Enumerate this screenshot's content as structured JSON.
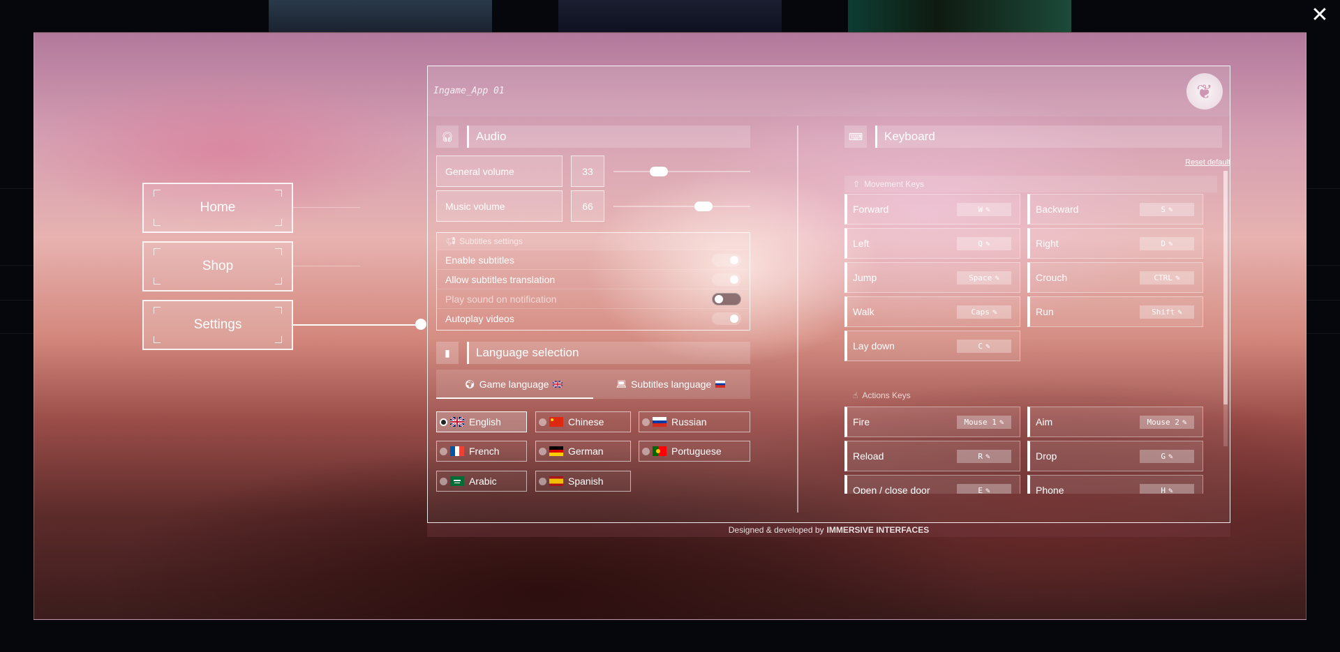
{
  "window": {
    "close_icon": "close-icon"
  },
  "nav": {
    "items": [
      {
        "label": "Home",
        "active": false
      },
      {
        "label": "Shop",
        "active": false
      },
      {
        "label": "Settings",
        "active": true
      }
    ]
  },
  "app": {
    "title": "Ingame_App 01",
    "logo_icon": "phoenix-logo-icon"
  },
  "audio": {
    "title": "Audio",
    "icon": "headphones-icon",
    "general_volume": {
      "label": "General volume",
      "value": "33",
      "level": 0.33
    },
    "music_volume": {
      "label": "Music volume",
      "value": "66",
      "level": 0.66
    }
  },
  "subtitles": {
    "title": "Subtitles settings",
    "icon": "megaphone-icon",
    "options": [
      {
        "label": "Enable subtitles",
        "on": true
      },
      {
        "label": "Allow subtitles translation",
        "on": true
      },
      {
        "label": "Play sound on notification",
        "on": false
      },
      {
        "label": "Autoplay videos",
        "on": true
      }
    ]
  },
  "language": {
    "title": "Language selection",
    "icon": "chat-bubble-icon",
    "tabs": [
      {
        "label": "Game language",
        "icon": "globe-icon",
        "flag": "uk-flag-icon",
        "active": true
      },
      {
        "label": "Subtitles language",
        "icon": "laptop-icon",
        "flag": "russia-flag-icon",
        "active": false
      }
    ],
    "options": [
      {
        "label": "English",
        "flag": "uk",
        "selected": true
      },
      {
        "label": "Chinese",
        "flag": "china",
        "selected": false
      },
      {
        "label": "Russian",
        "flag": "russia",
        "selected": false
      },
      {
        "label": "French",
        "flag": "france",
        "selected": false
      },
      {
        "label": "German",
        "flag": "germany",
        "selected": false
      },
      {
        "label": "Portuguese",
        "flag": "portugal",
        "selected": false
      },
      {
        "label": "Arabic",
        "flag": "saudi",
        "selected": false
      },
      {
        "label": "Spanish",
        "flag": "spain",
        "selected": false
      }
    ]
  },
  "keyboard": {
    "title": "Keyboard",
    "icon": "keyboard-icon",
    "reset_label": "Reset default",
    "movement": {
      "title": "Movement Keys",
      "icon": "arrow-up-icon",
      "keys": [
        {
          "label": "Forward",
          "key": "W"
        },
        {
          "label": "Backward",
          "key": "S"
        },
        {
          "label": "Left",
          "key": "Q"
        },
        {
          "label": "Right",
          "key": "D"
        },
        {
          "label": "Jump",
          "key": "Space"
        },
        {
          "label": "Crouch",
          "key": "CTRL"
        },
        {
          "label": "Walk",
          "key": "Caps"
        },
        {
          "label": "Run",
          "key": "Shift"
        },
        {
          "label": "Lay down",
          "key": "C"
        }
      ]
    },
    "actions": {
      "title": "Actions Keys",
      "icon": "hand-pointer-icon",
      "keys": [
        {
          "label": "Fire",
          "key": "Mouse 1"
        },
        {
          "label": "Aim",
          "key": "Mouse 2"
        },
        {
          "label": "Reload",
          "key": "R"
        },
        {
          "label": "Drop",
          "key": "G"
        },
        {
          "label": "Open / close door",
          "key": "E"
        },
        {
          "label": "Phone",
          "key": "H"
        }
      ]
    }
  },
  "footer": {
    "prefix": "Designed & developed by",
    "brand": "IMMERSIVE INTERFACES"
  }
}
